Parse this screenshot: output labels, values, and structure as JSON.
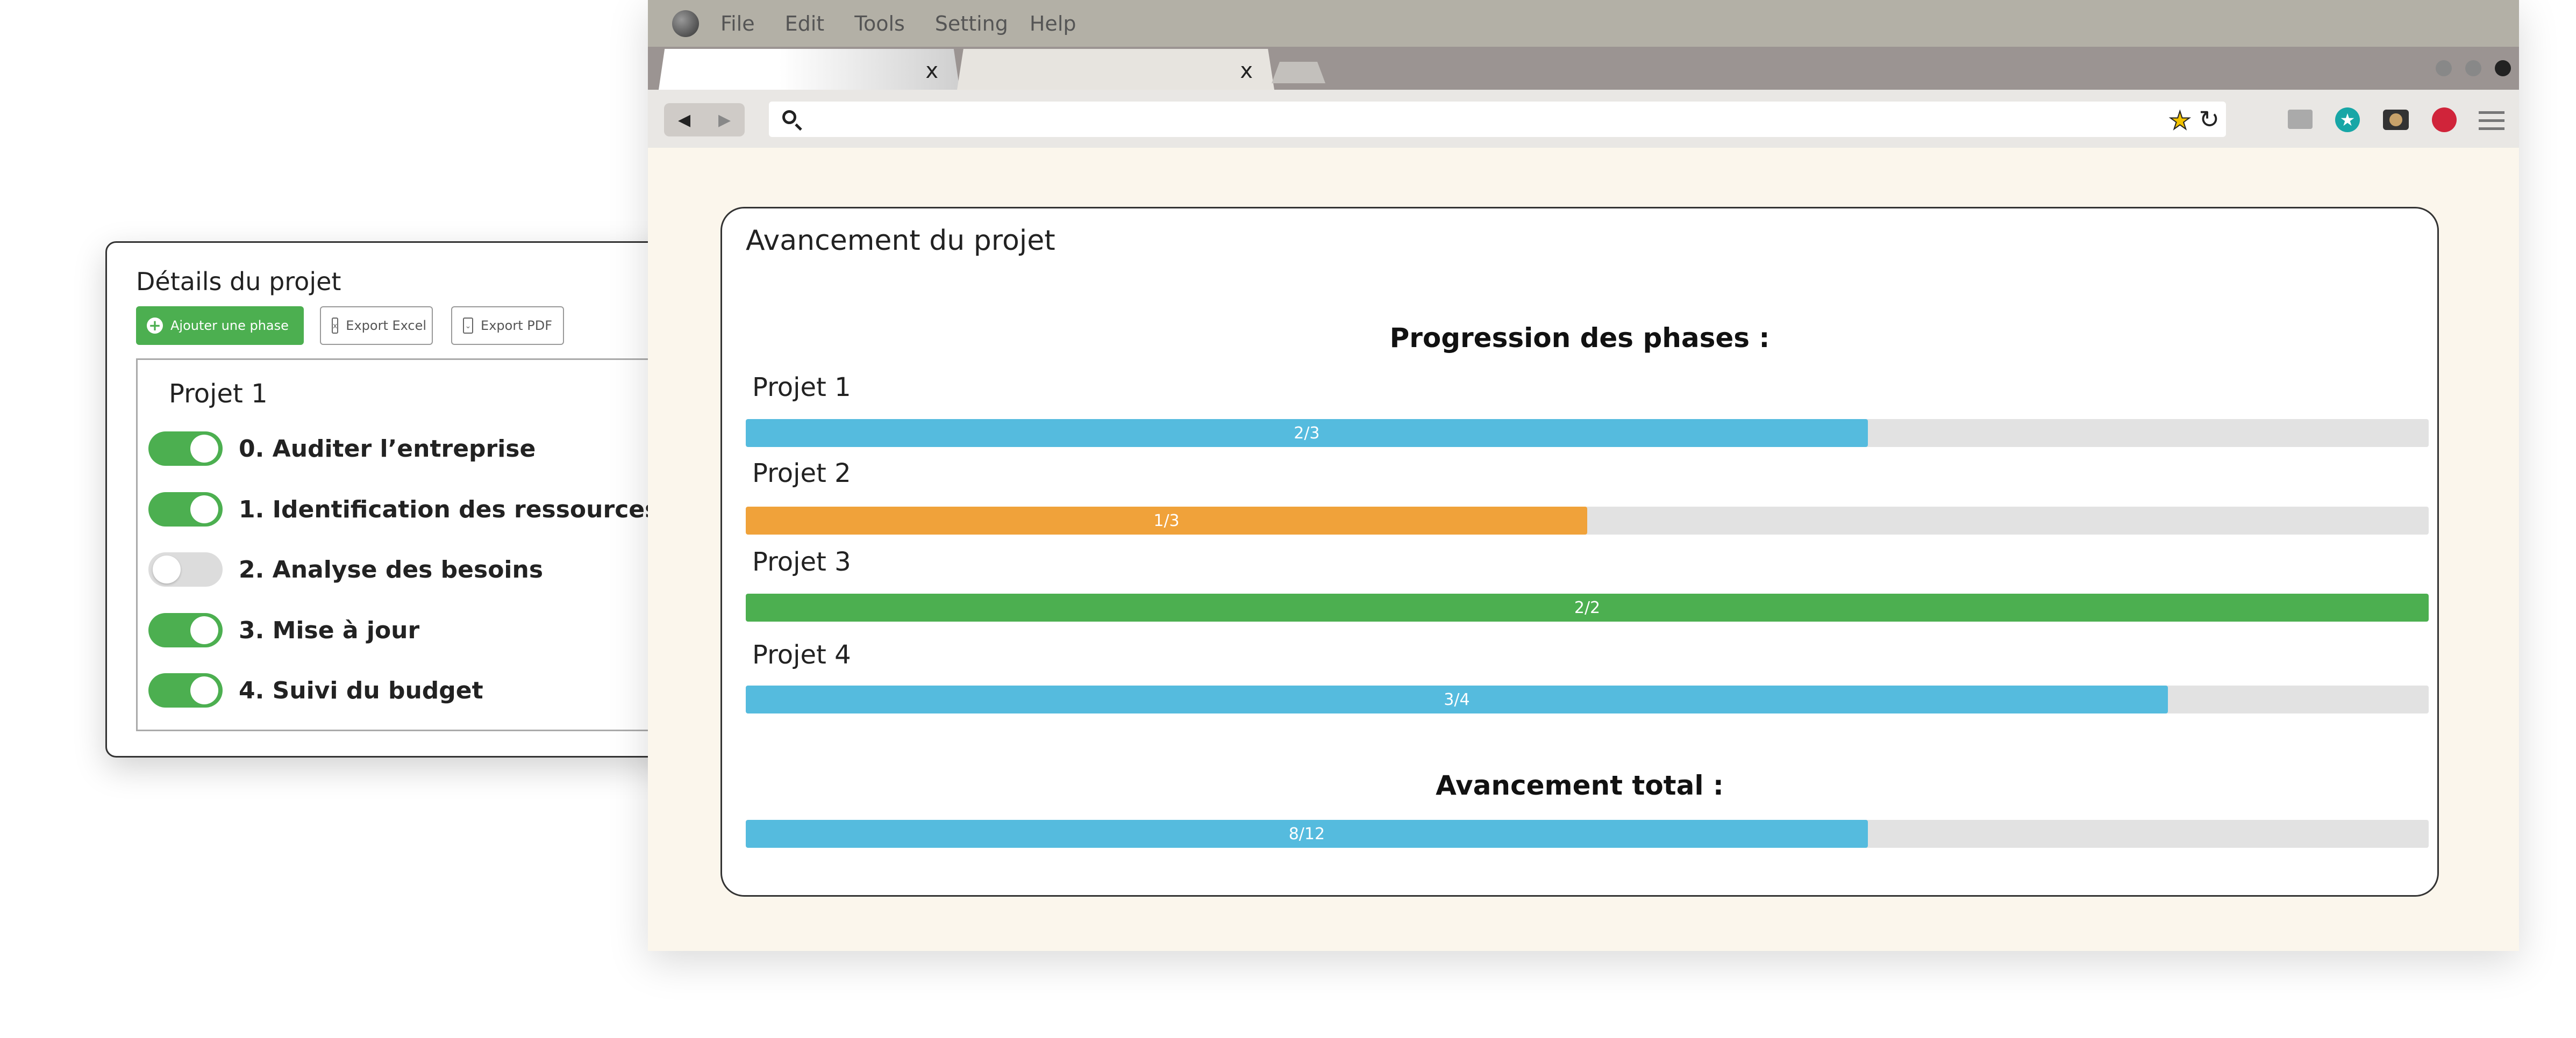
{
  "details_panel": {
    "title": "Détails du projet",
    "buttons": {
      "add_phase": "Ajouter une phase",
      "export_excel": "Export Excel",
      "export_pdf": "Export PDF"
    },
    "project_name": "Projet 1",
    "phases": [
      {
        "label": "0. Auditer l’entreprise",
        "enabled": true
      },
      {
        "label": "1. Identification des ressources",
        "enabled": true
      },
      {
        "label": "2. Analyse des besoins",
        "enabled": false
      },
      {
        "label": "3. Mise à jour",
        "enabled": true
      },
      {
        "label": "4. Suivi du budget",
        "enabled": true
      }
    ]
  },
  "browser": {
    "menu": [
      "File",
      "Edit",
      "Tools",
      "Setting",
      "Help"
    ],
    "tabs": [
      {
        "close": "x"
      },
      {
        "close": "x"
      }
    ],
    "address": {
      "value": ""
    }
  },
  "progress": {
    "card_title": "Avancement du projet",
    "section_title": "Progression des phases :",
    "projects": [
      {
        "name": "Projet 1",
        "label": "2/3",
        "fraction": 0.6667,
        "color": "#55bbde"
      },
      {
        "name": "Projet 2",
        "label": "1/3",
        "fraction": 0.5,
        "color": "#f0a23a"
      },
      {
        "name": "Projet 3",
        "label": "2/2",
        "fraction": 1.0,
        "color": "#4caf50"
      },
      {
        "name": "Projet 4",
        "label": "3/4",
        "fraction": 0.845,
        "color": "#55bbde"
      }
    ],
    "total_title": "Avancement total :",
    "total": {
      "label": "8/12",
      "fraction": 0.6667,
      "color": "#55bbde"
    }
  },
  "colors": {
    "accent_green": "#4caf50",
    "browser_background": "#fbf6ec"
  }
}
